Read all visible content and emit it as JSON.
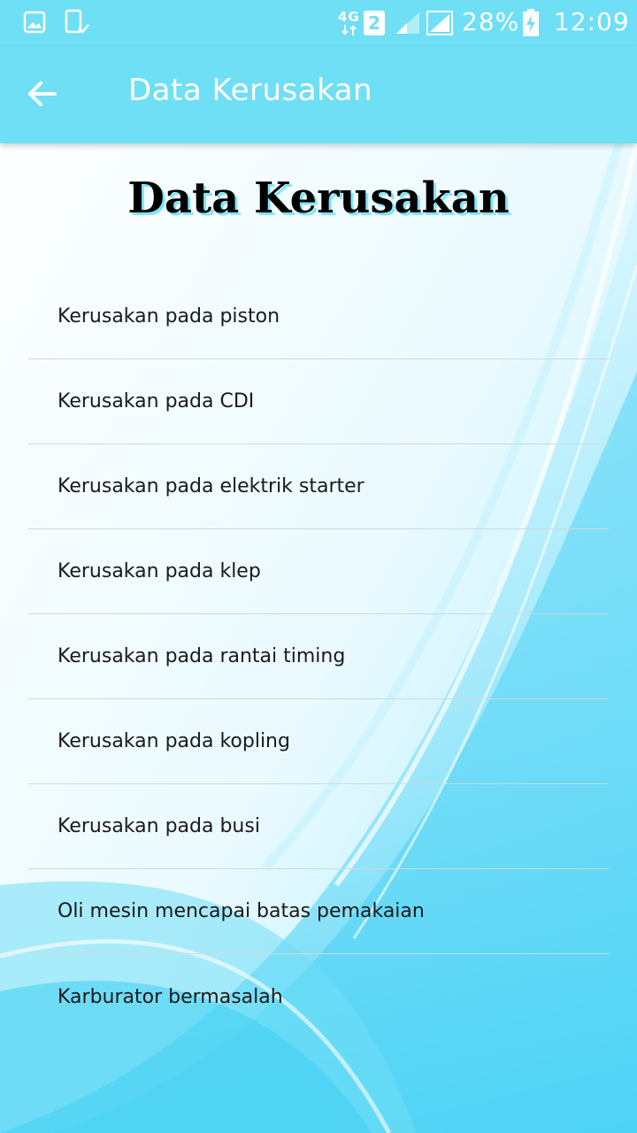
{
  "status_bar": {
    "network_label": "4G",
    "sim_badge": "2",
    "battery_percent": "28%",
    "time": "12:09"
  },
  "app_bar": {
    "title": "Data Kerusakan"
  },
  "page": {
    "heading": "Data Kerusakan"
  },
  "items": [
    {
      "label": "Kerusakan pada piston"
    },
    {
      "label": "Kerusakan pada CDI"
    },
    {
      "label": "Kerusakan pada elektrik starter"
    },
    {
      "label": "Kerusakan pada klep"
    },
    {
      "label": "Kerusakan pada rantai timing"
    },
    {
      "label": "Kerusakan pada kopling"
    },
    {
      "label": "Kerusakan pada busi"
    },
    {
      "label": "Oli mesin mencapai batas pemakaian"
    },
    {
      "label": "Karburator bermasalah"
    }
  ],
  "colors": {
    "accent": "#6fdff5",
    "background_wave": "#3fcff3"
  }
}
